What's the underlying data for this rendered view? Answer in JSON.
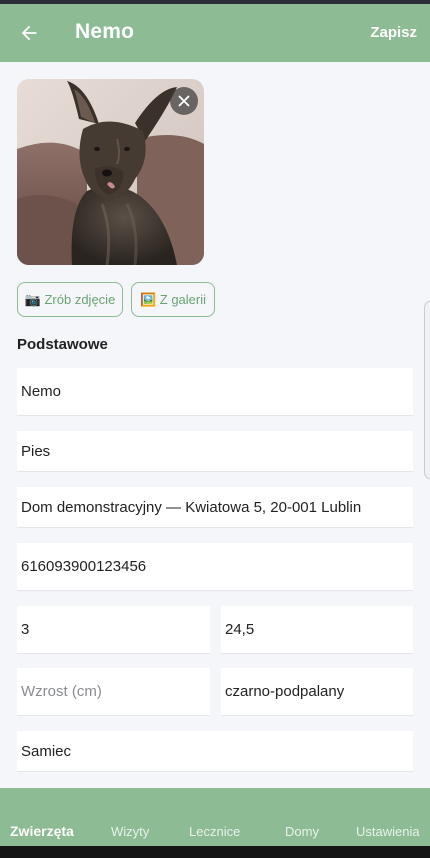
{
  "header": {
    "title": "Nemo",
    "save_label": "Zapisz"
  },
  "photo_actions": {
    "take_photo": "📷 Zrób zdjęcie",
    "from_gallery": "🖼️ Z galerii"
  },
  "section": {
    "title": "Podstawowe"
  },
  "fields": {
    "name": {
      "value": "Nemo",
      "placeholder": ""
    },
    "species": {
      "value": "Pies",
      "placeholder": ""
    },
    "home": {
      "value": "Dom demonstracyjny — Kwiatowa 5, 20-001 Lublin",
      "placeholder": ""
    },
    "chip": {
      "value": "616093900123456",
      "placeholder": ""
    },
    "age": {
      "value": "3",
      "placeholder": ""
    },
    "weight": {
      "value": "24,5",
      "placeholder": ""
    },
    "height": {
      "value": "",
      "placeholder": "Wzrost (cm)"
    },
    "color": {
      "value": "czarno-podpalany",
      "placeholder": ""
    },
    "sex": {
      "value": "Samiec",
      "placeholder": ""
    }
  },
  "nav": {
    "items": [
      {
        "label": "Zwierzęta",
        "active": true
      },
      {
        "label": "Wizyty",
        "active": false
      },
      {
        "label": "Lecznice",
        "active": false
      },
      {
        "label": "Domy",
        "active": false
      },
      {
        "label": "Ustawienia",
        "active": false
      }
    ]
  },
  "colors": {
    "accent": "#8cbb94",
    "accent_text": "#6aa474",
    "background": "#f5f6fa"
  }
}
